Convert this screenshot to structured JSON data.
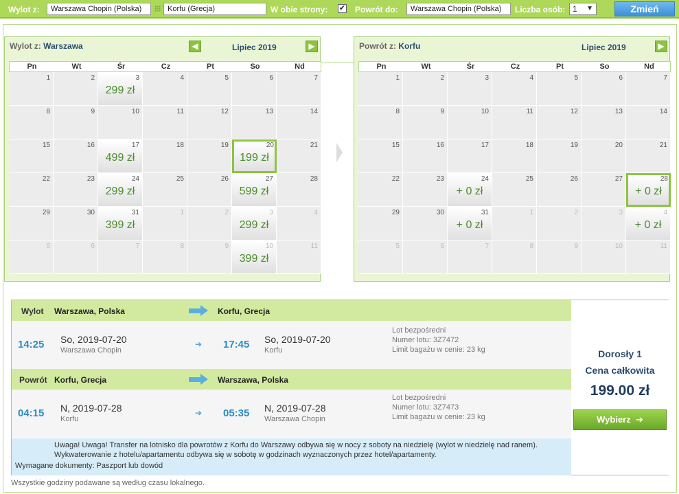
{
  "search": {
    "from_label": "Wylot z:",
    "from_value": "Warszawa Chopin (Polska)",
    "to_value": "Korfu (Grecja)",
    "roundtrip_label": "W obie strony:",
    "roundtrip_checked": "✔",
    "return_label": "Powrót do:",
    "return_value": "Warszawa Chopin (Polska)",
    "persons_label": "Liczba osób:",
    "persons_value": "1",
    "change_button": "Zmień"
  },
  "outbound_calendar": {
    "title_prefix": "Wylot z:",
    "title_city": "Warszawa",
    "month": "Lipiec 2019",
    "weekdays": [
      "Pn",
      "Wt",
      "Śr",
      "Cz",
      "Pt",
      "So",
      "Nd"
    ],
    "days": [
      {
        "n": "1"
      },
      {
        "n": "2"
      },
      {
        "n": "3",
        "p": "299 zł"
      },
      {
        "n": "4"
      },
      {
        "n": "5"
      },
      {
        "n": "6"
      },
      {
        "n": "7"
      },
      {
        "n": "8"
      },
      {
        "n": "9"
      },
      {
        "n": "10"
      },
      {
        "n": "11"
      },
      {
        "n": "12"
      },
      {
        "n": "13"
      },
      {
        "n": "14"
      },
      {
        "n": "15"
      },
      {
        "n": "16"
      },
      {
        "n": "17",
        "p": "499 zł"
      },
      {
        "n": "18"
      },
      {
        "n": "19"
      },
      {
        "n": "20",
        "p": "199 zł",
        "sel": true
      },
      {
        "n": "21"
      },
      {
        "n": "22"
      },
      {
        "n": "23"
      },
      {
        "n": "24",
        "p": "299 zł"
      },
      {
        "n": "25"
      },
      {
        "n": "26"
      },
      {
        "n": "27",
        "p": "599 zł"
      },
      {
        "n": "28"
      },
      {
        "n": "29"
      },
      {
        "n": "30"
      },
      {
        "n": "31",
        "p": "399 zł"
      },
      {
        "n": "1",
        "o": true
      },
      {
        "n": "2",
        "o": true
      },
      {
        "n": "3",
        "o": true,
        "p": "299 zł"
      },
      {
        "n": "4",
        "o": true
      },
      {
        "n": "5",
        "o": true
      },
      {
        "n": "6",
        "o": true
      },
      {
        "n": "7",
        "o": true
      },
      {
        "n": "8",
        "o": true
      },
      {
        "n": "9",
        "o": true
      },
      {
        "n": "10",
        "o": true,
        "p": "399 zł"
      },
      {
        "n": "11",
        "o": true
      }
    ]
  },
  "return_calendar": {
    "title_prefix": "Powrót z:",
    "title_city": "Korfu",
    "month": "Lipiec 2019",
    "weekdays": [
      "Pn",
      "Wt",
      "Śr",
      "Cz",
      "Pt",
      "So",
      "Nd"
    ],
    "days": [
      {
        "n": "1"
      },
      {
        "n": "2"
      },
      {
        "n": "3"
      },
      {
        "n": "4"
      },
      {
        "n": "5"
      },
      {
        "n": "6"
      },
      {
        "n": "7"
      },
      {
        "n": "8"
      },
      {
        "n": "9"
      },
      {
        "n": "10"
      },
      {
        "n": "11"
      },
      {
        "n": "12"
      },
      {
        "n": "13"
      },
      {
        "n": "14"
      },
      {
        "n": "15"
      },
      {
        "n": "16"
      },
      {
        "n": "17"
      },
      {
        "n": "18"
      },
      {
        "n": "19"
      },
      {
        "n": "20"
      },
      {
        "n": "21"
      },
      {
        "n": "22"
      },
      {
        "n": "23"
      },
      {
        "n": "24",
        "p": "+ 0 zł"
      },
      {
        "n": "25"
      },
      {
        "n": "26"
      },
      {
        "n": "27"
      },
      {
        "n": "28",
        "p": "+ 0 zł",
        "sel": true
      },
      {
        "n": "29"
      },
      {
        "n": "30"
      },
      {
        "n": "31",
        "p": "+ 0 zł"
      },
      {
        "n": "1",
        "o": true
      },
      {
        "n": "2",
        "o": true
      },
      {
        "n": "3",
        "o": true
      },
      {
        "n": "4",
        "o": true,
        "p": "+ 0 zł"
      },
      {
        "n": "5",
        "o": true
      },
      {
        "n": "6",
        "o": true
      },
      {
        "n": "7",
        "o": true
      },
      {
        "n": "8",
        "o": true
      },
      {
        "n": "9",
        "o": true
      },
      {
        "n": "10",
        "o": true
      },
      {
        "n": "11",
        "o": true
      }
    ]
  },
  "outbound_leg": {
    "label": "Wylot",
    "from": "Warszawa, Polska",
    "to": "Korfu, Grecja",
    "dep_time": "14:25",
    "dep_date": "So, 2019-07-20",
    "dep_airport": "Warszawa Chopin",
    "arr_time": "17:45",
    "arr_date": "So, 2019-07-20",
    "arr_airport": "Korfu",
    "info_direct": "Lot bezpośredni",
    "info_flight": "Numer lotu: 3Z7472",
    "info_baggage": "Limit bagażu w cenie: 23 kg"
  },
  "return_leg": {
    "label": "Powrót",
    "from": "Korfu, Grecja",
    "to": "Warszawa, Polska",
    "dep_time": "04:15",
    "dep_date": "N, 2019-07-28",
    "dep_airport": "Korfu",
    "arr_time": "05:35",
    "arr_date": "N, 2019-07-28",
    "arr_airport": "Warszawa Chopin",
    "info_direct": "Lot bezpośredni",
    "info_flight": "Numer lotu: 3Z7473",
    "info_baggage": "Limit bagażu w cenie: 23 kg"
  },
  "notice": {
    "warning": "Uwaga! Uwaga! Transfer na lotnisko dla powrotów z Korfu do Warszawy odbywa się w nocy z soboty na niedzielę (wylot w niedzielę nad ranem). Wykwaterowanie z hotelu/apartamentu odbywa się w sobotę w godzinach wyznaczonych przez hotel/apartamenty.",
    "documents": "Wymagane dokumenty: Paszport lub dowód"
  },
  "pricing": {
    "adult": "Dorosły 1",
    "total_label": "Cena całkowita",
    "total": "199.00 zł",
    "choose_button": "Wybierz"
  },
  "footer": "Wszystkie godziny podawane są według czasu lokalnego.",
  "colors": {
    "accent_green": "#8cc43f",
    "price_green": "#4a8c2a",
    "time_blue": "#2a8cc4",
    "header_bar": "#aed85a"
  }
}
